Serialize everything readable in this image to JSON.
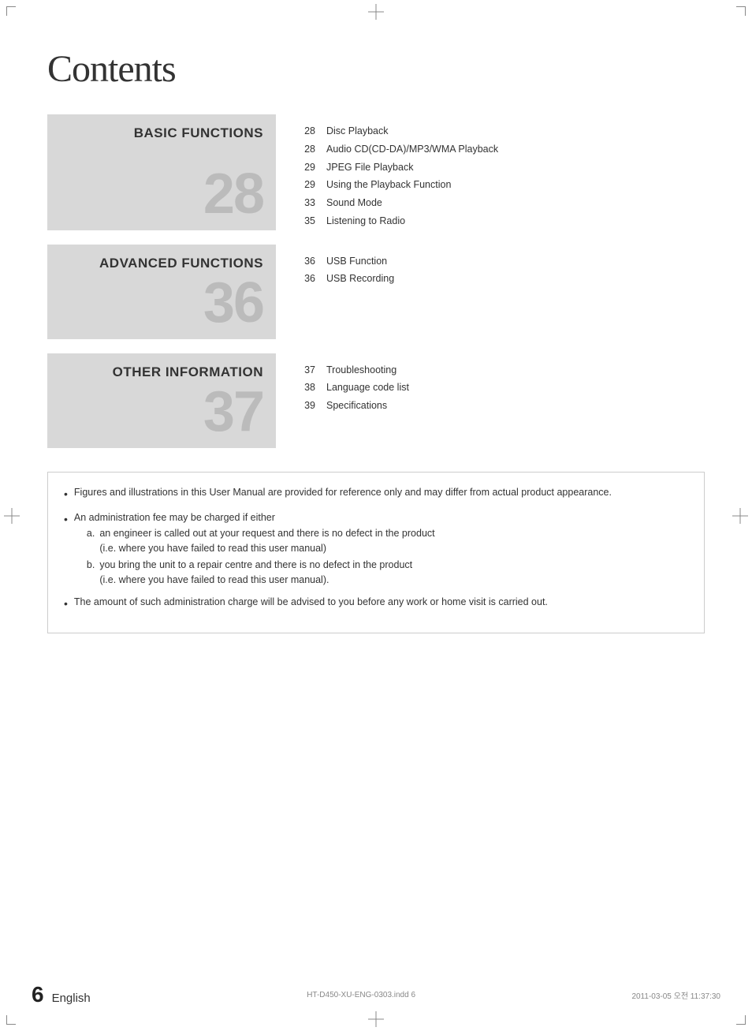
{
  "page": {
    "title": "Contents"
  },
  "sections": [
    {
      "id": "basic-functions",
      "title": "BASIC FUNCTIONS",
      "number": "28",
      "items": [
        {
          "page": "28",
          "text": "Disc Playback"
        },
        {
          "page": "28",
          "text": "Audio CD(CD-DA)/MP3/WMA Playback"
        },
        {
          "page": "29",
          "text": "JPEG File Playback"
        },
        {
          "page": "29",
          "text": "Using the Playback Function"
        },
        {
          "page": "33",
          "text": "Sound Mode"
        },
        {
          "page": "35",
          "text": "Listening to Radio"
        }
      ]
    },
    {
      "id": "advanced-functions",
      "title": "ADVANCED FUNCTIONS",
      "number": "36",
      "items": [
        {
          "page": "36",
          "text": "USB Function"
        },
        {
          "page": "36",
          "text": "USB Recording"
        }
      ]
    },
    {
      "id": "other-information",
      "title": "OTHER INFORMATION",
      "number": "37",
      "items": [
        {
          "page": "37",
          "text": "Troubleshooting"
        },
        {
          "page": "38",
          "text": "Language code list"
        },
        {
          "page": "39",
          "text": "Specifications"
        }
      ]
    }
  ],
  "notes": [
    {
      "type": "bullet",
      "text": "Figures and illustrations in this User Manual are provided for reference only and may differ from actual product appearance."
    },
    {
      "type": "bullet",
      "text": "An administration fee may be charged if either",
      "subitems": [
        {
          "label": "a.",
          "text": "an engineer is called out at your request and there is no defect in the product\n(i.e. where you have failed to read this user manual)"
        },
        {
          "label": "b.",
          "text": "you bring the unit to a repair centre and there is no defect in the product\n(i.e. where you have failed to read this user manual)."
        }
      ]
    },
    {
      "type": "bullet",
      "text": "The amount of such administration charge will be advised to you before any work or home visit is carried out."
    }
  ],
  "footer": {
    "page_number": "6",
    "language": "English",
    "file_info": "HT-D450-XU-ENG-0303.indd  6",
    "date": "2011-03-05  오전 11:37:30"
  }
}
